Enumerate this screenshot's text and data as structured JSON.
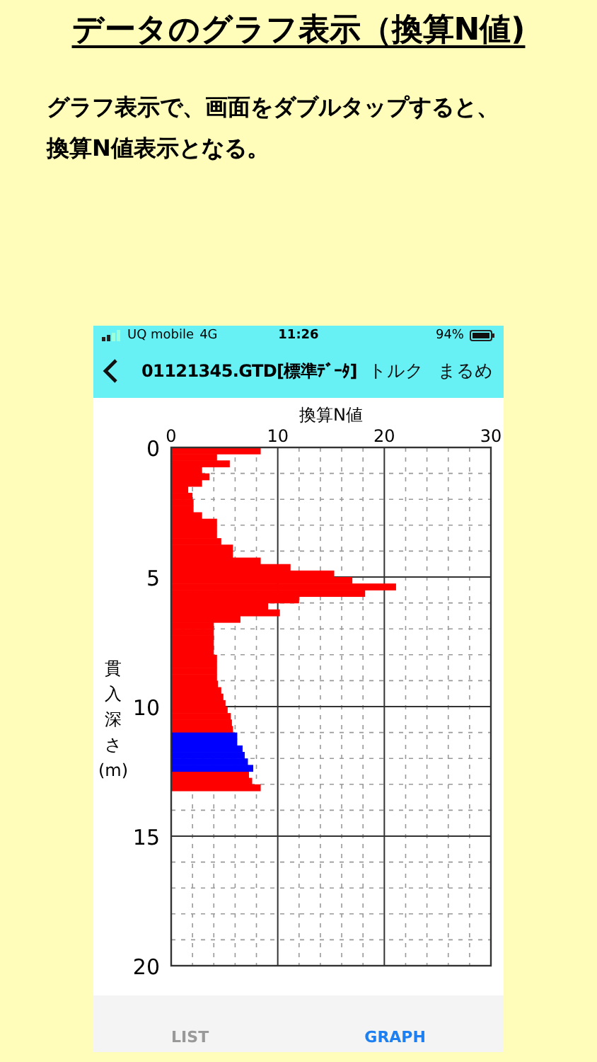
{
  "heading": "データのグラフ表示（換算N値)",
  "description": [
    "グラフ表示で、画面をダブルタップすると、",
    "換算N値表示となる。"
  ],
  "phone": {
    "status_bar": {
      "carrier": "UQ mobile",
      "network": "4G",
      "time": "11:26",
      "battery": "94%"
    },
    "nav_bar": {
      "title": "01121345.GTD[標準ﾃﾞｰﾀ]",
      "buttons": [
        "トルク",
        "まるめ"
      ]
    },
    "chart_data": {
      "type": "bar",
      "orientation": "horizontal",
      "grid": true,
      "xlabel": "換算N値",
      "ylabel": "貫入深さ(m)",
      "xlim": [
        0,
        30
      ],
      "ylim": [
        20,
        0
      ],
      "xticks": [
        0,
        10,
        20,
        30
      ],
      "yticks": [
        0,
        5,
        10,
        15,
        20
      ],
      "x": [
        0,
        0.25,
        0.5,
        0.75,
        1,
        1.25,
        1.5,
        1.75,
        2,
        2.25,
        2.5,
        2.75,
        3,
        3.25,
        3.5,
        3.75,
        4,
        4.25,
        4.5,
        4.75,
        5,
        5.25,
        5.5,
        5.75,
        6,
        6.25,
        6.5,
        6.75,
        7,
        7.25,
        7.5,
        7.75,
        8,
        8.25,
        8.5,
        8.75,
        9,
        9.25,
        9.5,
        9.75,
        10,
        10.25,
        10.5,
        10.75,
        11,
        11.25,
        11.5,
        11.75,
        12,
        12.25,
        12.5,
        12.75,
        13
      ],
      "series": [
        {
          "color": "#ff0000",
          "values": [
            8.4,
            4.3,
            5.5,
            2.9,
            3.6,
            2.9,
            1.6,
            2.0,
            2.1,
            2.1,
            2.9,
            4.3,
            4.3,
            4.3,
            4.7,
            5.8,
            5.8,
            8.4,
            11.2,
            15.3,
            17.0,
            21.1,
            18.2,
            12.0,
            9.1,
            10.2,
            6.5,
            4.0,
            4.0,
            4.0,
            4.0,
            4.0,
            4.3,
            4.3,
            4.3,
            4.3,
            4.4,
            4.7,
            4.9,
            5.1,
            5.3,
            5.6,
            5.7,
            5.8,
            null,
            null,
            null,
            null,
            null,
            null,
            7.3,
            7.6,
            8.4
          ]
        },
        {
          "color": "#0000ff",
          "values": [
            null,
            null,
            null,
            null,
            null,
            null,
            null,
            null,
            null,
            null,
            null,
            null,
            null,
            null,
            null,
            null,
            null,
            null,
            null,
            null,
            null,
            null,
            null,
            null,
            null,
            null,
            null,
            null,
            null,
            null,
            null,
            null,
            null,
            null,
            null,
            null,
            null,
            null,
            null,
            null,
            null,
            null,
            null,
            null,
            6.2,
            6.2,
            6.7,
            6.9,
            7.2,
            7.7,
            null,
            null,
            null
          ]
        }
      ]
    },
    "tabs": [
      {
        "label": "LIST",
        "selected": false
      },
      {
        "label": "GRAPH",
        "selected": true
      }
    ]
  }
}
